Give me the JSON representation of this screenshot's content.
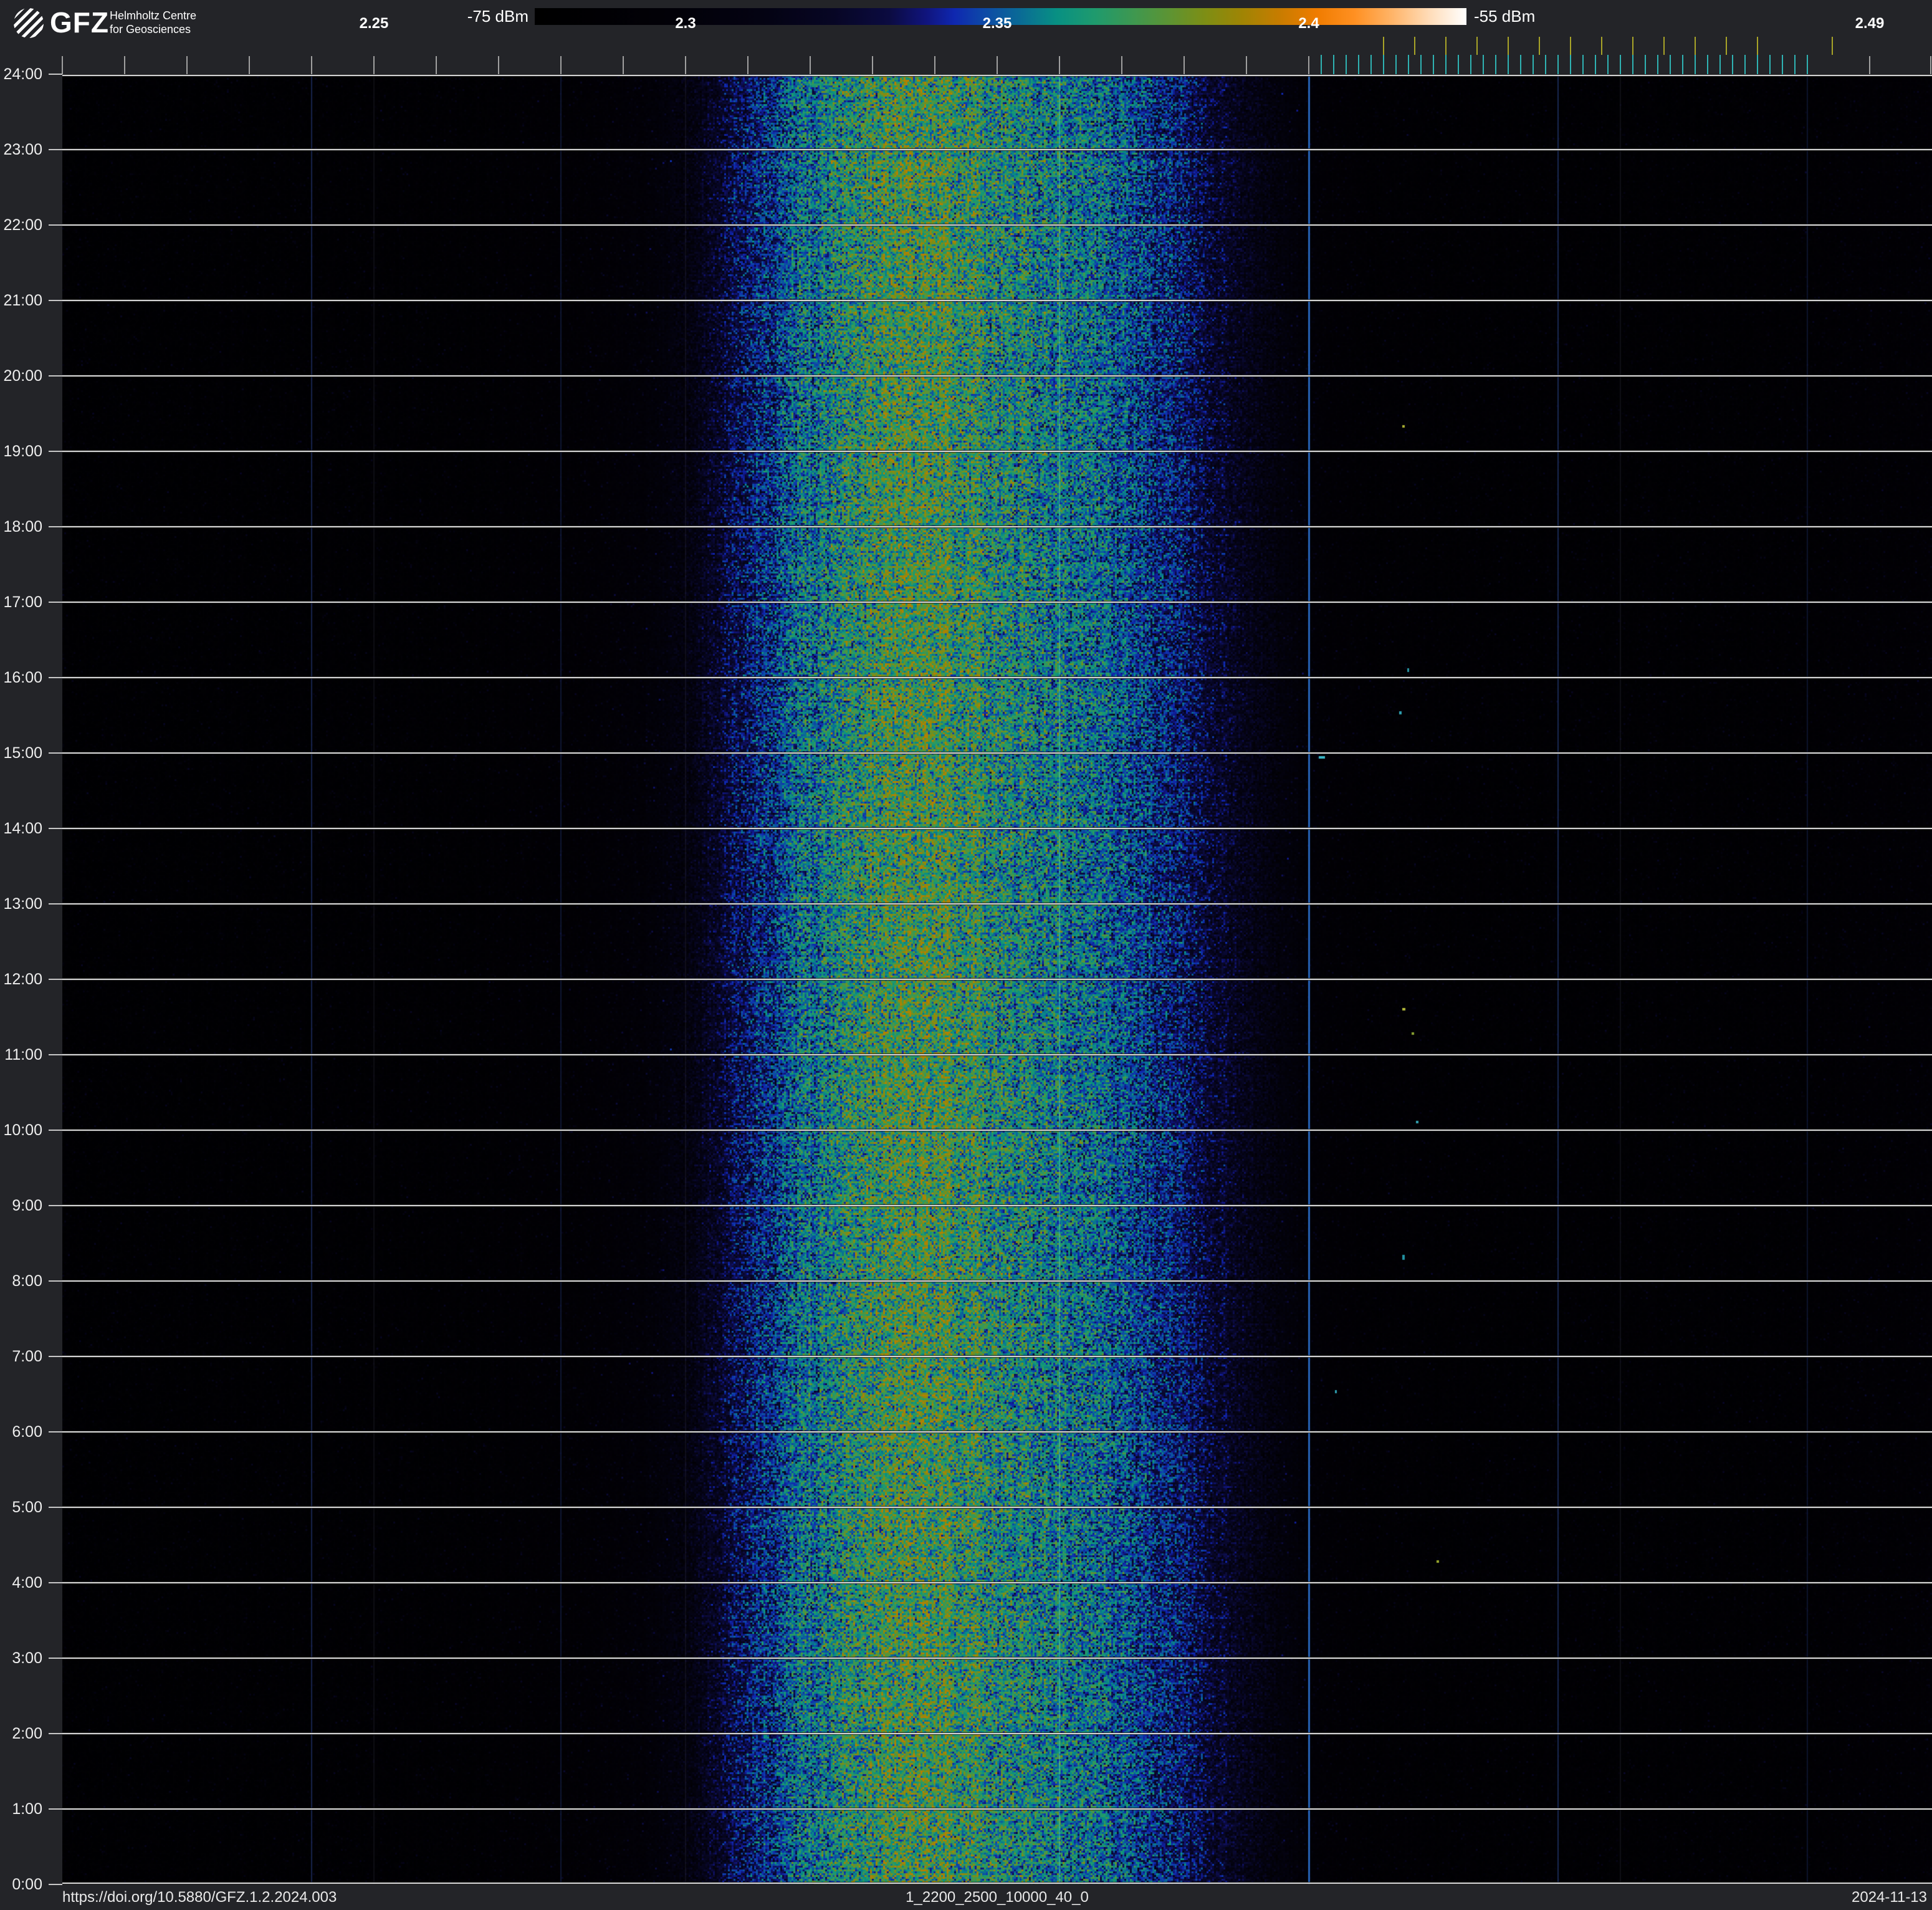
{
  "logo": {
    "org": "GFZ",
    "line1": "Helmholtz Centre",
    "line2": "for Geosciences"
  },
  "colorbar": {
    "min_label": "-75 dBm",
    "max_label": "-55 dBm"
  },
  "footer": {
    "doi": "https://doi.org/10.5880/GFZ.1.2.2024.003",
    "dataset_id": "1_2200_2500_10000_40_0",
    "date": "2024-11-13"
  },
  "chart_data": {
    "type": "heatmap",
    "title": "24h radio spectrogram 2.2-2.5 GHz",
    "x_axis": {
      "unit": "GHz",
      "min": 2.2,
      "max": 2.5,
      "minor_tick_step_ghz": 0.01,
      "labeled_ticks": [
        {
          "text": "2.25",
          "f": 2.25
        },
        {
          "text": "2.3",
          "f": 2.3
        },
        {
          "text": "2.35",
          "f": 2.35
        },
        {
          "text": "2.4",
          "f": 2.4
        },
        {
          "text": "2.49",
          "f": 2.49
        }
      ]
    },
    "y_axis": {
      "unit": "time of day",
      "top": "24:00",
      "bottom": "0:00",
      "labels": [
        "24:00",
        "23:00",
        "22:00",
        "21:00",
        "20:00",
        "19:00",
        "18:00",
        "17:00",
        "16:00",
        "15:00",
        "14:00",
        "13:00",
        "12:00",
        "11:00",
        "10:00",
        "9:00",
        "8:00",
        "7:00",
        "6:00",
        "5:00",
        "4:00",
        "3:00",
        "2:00",
        "1:00",
        "0:00"
      ]
    },
    "colorbar": {
      "min_dbm": -75,
      "max_dbm": -55,
      "gradient": [
        [
          0.0,
          "#000000"
        ],
        [
          0.15,
          "#020108"
        ],
        [
          0.25,
          "#040313"
        ],
        [
          0.32,
          "#070624"
        ],
        [
          0.38,
          "#0b0b40"
        ],
        [
          0.42,
          "#10147c"
        ],
        [
          0.45,
          "#0f27b0"
        ],
        [
          0.48,
          "#0d47a8"
        ],
        [
          0.52,
          "#0a6a96"
        ],
        [
          0.56,
          "#089083"
        ],
        [
          0.6,
          "#1e9a6e"
        ],
        [
          0.64,
          "#3c9852"
        ],
        [
          0.68,
          "#5c9434"
        ],
        [
          0.72,
          "#7e8e14"
        ],
        [
          0.76,
          "#a08404"
        ],
        [
          0.8,
          "#c87c00"
        ],
        [
          0.84,
          "#f07c00"
        ],
        [
          0.88,
          "#ff9022"
        ],
        [
          0.92,
          "#ffb468"
        ],
        [
          0.96,
          "#ffdcb8"
        ],
        [
          1.0,
          "#ffffff"
        ]
      ]
    },
    "spectrum_profile": [
      [
        2.2,
        0.05
      ],
      [
        2.225,
        0.055
      ],
      [
        2.25,
        0.058
      ],
      [
        2.27,
        0.065
      ],
      [
        2.283,
        0.085
      ],
      [
        2.293,
        0.13
      ],
      [
        2.3,
        0.2
      ],
      [
        2.306,
        0.33
      ],
      [
        2.312,
        0.42
      ],
      [
        2.318,
        0.5
      ],
      [
        2.324,
        0.56
      ],
      [
        2.33,
        0.61
      ],
      [
        2.336,
        0.63
      ],
      [
        2.342,
        0.62
      ],
      [
        2.348,
        0.58
      ],
      [
        2.354,
        0.555
      ],
      [
        2.36,
        0.535
      ],
      [
        2.366,
        0.51
      ],
      [
        2.372,
        0.465
      ],
      [
        2.378,
        0.41
      ],
      [
        2.384,
        0.34
      ],
      [
        2.39,
        0.26
      ],
      [
        2.395,
        0.185
      ],
      [
        2.399,
        0.13
      ],
      [
        2.403,
        0.085
      ],
      [
        2.41,
        0.068
      ],
      [
        2.425,
        0.062
      ],
      [
        2.445,
        0.06
      ],
      [
        2.465,
        0.06
      ],
      [
        2.478,
        0.065
      ],
      [
        2.488,
        0.078
      ],
      [
        2.5,
        0.085
      ]
    ],
    "channel_markers": {
      "bluetooth": {
        "start_ghz": 2.402,
        "end_ghz": 2.48,
        "step_ghz": 0.002,
        "color": "#2fb3b3"
      },
      "wifi": {
        "centers_ghz": [
          2.412,
          2.417,
          2.422,
          2.427,
          2.432,
          2.437,
          2.442,
          2.447,
          2.452,
          2.457,
          2.462,
          2.467,
          2.472,
          2.484
        ],
        "color": "#a8a428"
      }
    },
    "grid": {
      "hour_step": 1,
      "hour_line_color": "#f2f2f2",
      "freq_gridline_step_ghz": 0.05,
      "freq_gridline_color": "rgba(150,160,200,0.09)"
    },
    "seam_lines": [
      {
        "f": 2.24,
        "w": 2,
        "color": "rgba(55,85,180,0.40)"
      },
      {
        "f": 2.28,
        "w": 2,
        "color": "rgba(50,80,170,0.28)"
      },
      {
        "f": 2.32,
        "w": 2,
        "color": "rgba(90,190,180,0.18)"
      },
      {
        "f": 2.36,
        "w": 2,
        "color": "rgba(70,200,190,0.50)"
      },
      {
        "f": 2.4,
        "w": 3,
        "color": "rgba(45,120,220,0.80)"
      },
      {
        "f": 2.44,
        "w": 2,
        "color": "rgba(60,100,200,0.40)"
      },
      {
        "f": 2.48,
        "w": 2,
        "color": "rgba(45,75,160,0.25)"
      }
    ],
    "artifacts": [
      {
        "f": 2.4016,
        "hour": 14.96,
        "w": 10,
        "h": 4,
        "color": "#38b6c6"
      },
      {
        "f": 2.4145,
        "hour": 15.55,
        "w": 4,
        "h": 5,
        "color": "#2f9fb0"
      },
      {
        "f": 2.415,
        "hour": 19.35,
        "w": 4,
        "h": 4,
        "color": "#a8ae32"
      },
      {
        "f": 2.4158,
        "hour": 16.12,
        "w": 3,
        "h": 6,
        "color": "#2a98a6"
      },
      {
        "f": 2.415,
        "hour": 11.62,
        "w": 5,
        "h": 4,
        "color": "#b2b83a"
      },
      {
        "f": 2.4165,
        "hour": 11.3,
        "w": 4,
        "h": 4,
        "color": "#8aa232"
      },
      {
        "f": 2.4172,
        "hour": 10.12,
        "w": 4,
        "h": 4,
        "color": "#33a2b2"
      },
      {
        "f": 2.415,
        "hour": 8.35,
        "w": 4,
        "h": 8,
        "color": "#2292a2"
      },
      {
        "f": 2.4042,
        "hour": 6.55,
        "w": 3,
        "h": 5,
        "color": "#2f9fb0"
      },
      {
        "f": 2.4205,
        "hour": 4.3,
        "w": 4,
        "h": 4,
        "color": "#9aa82e"
      }
    ]
  }
}
